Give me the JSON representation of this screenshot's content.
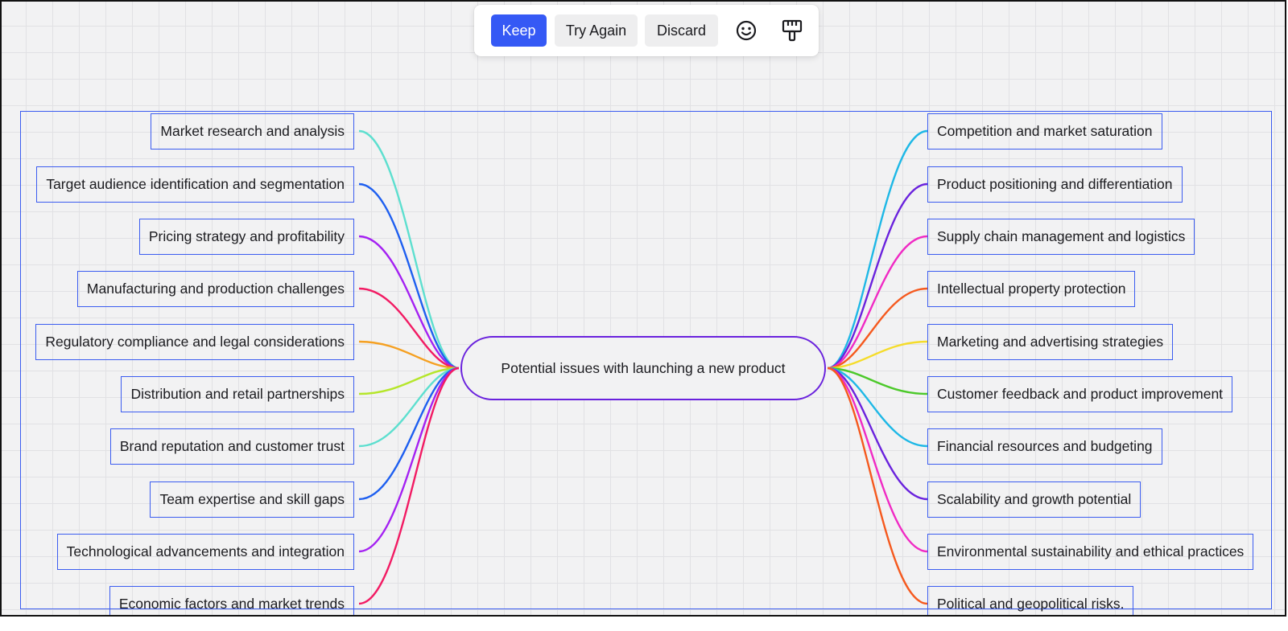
{
  "toolbar": {
    "keep_label": "Keep",
    "try_again_label": "Try Again",
    "discard_label": "Discard",
    "icons": [
      "feedback-smiley-icon",
      "style-paint-brush-icon"
    ],
    "accent": "#3559f5"
  },
  "mindmap": {
    "center": "Potential issues with launching a new product",
    "center_border_color": "#6a22dd",
    "left_branches": [
      {
        "label": "Market research and analysis",
        "color": "#5ddfcf"
      },
      {
        "label": "Target audience identification and segmentation",
        "color": "#1e5ff0"
      },
      {
        "label": "Pricing strategy and profitability",
        "color": "#a421f2"
      },
      {
        "label": "Manufacturing and production challenges",
        "color": "#f21b63"
      },
      {
        "label": "Regulatory compliance and legal considerations",
        "color": "#f5a021"
      },
      {
        "label": "Distribution and retail partnerships",
        "color": "#b5e62a"
      },
      {
        "label": "Brand reputation and customer trust",
        "color": "#5ddfcf"
      },
      {
        "label": "Team expertise and skill gaps",
        "color": "#1e5ff0"
      },
      {
        "label": "Technological advancements and integration",
        "color": "#a421f2"
      },
      {
        "label": "Economic factors and market trends",
        "color": "#f21b63"
      }
    ],
    "right_branches": [
      {
        "label": "Competition and market saturation",
        "color": "#1eb8e6"
      },
      {
        "label": "Product positioning and differentiation",
        "color": "#6a22dd"
      },
      {
        "label": "Supply chain management and logistics",
        "color": "#f02ac4"
      },
      {
        "label": "Intellectual property protection",
        "color": "#f5591e"
      },
      {
        "label": "Marketing and advertising strategies",
        "color": "#f5dc2a"
      },
      {
        "label": "Customer feedback and product improvement",
        "color": "#4cc92a"
      },
      {
        "label": "Financial resources and budgeting",
        "color": "#1eb8e6"
      },
      {
        "label": "Scalability and growth potential",
        "color": "#6a22dd"
      },
      {
        "label": "Environmental sustainability and ethical practices",
        "color": "#f02ac4"
      },
      {
        "label": "Political and geopolitical risks.",
        "color": "#f5591e"
      }
    ]
  }
}
